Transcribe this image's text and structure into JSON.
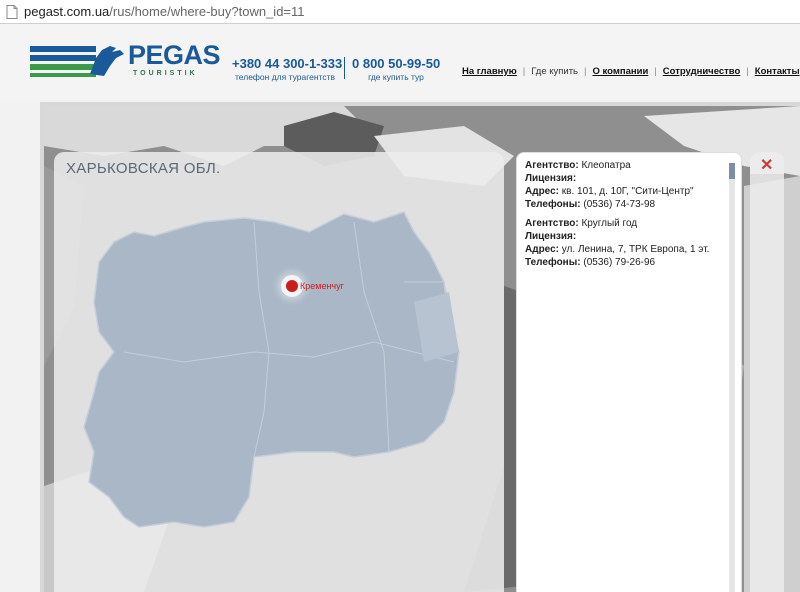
{
  "browser": {
    "url_host": "pegast.com.ua",
    "url_path": "/rus/home/where-buy?town_id=11"
  },
  "header": {
    "logo_word": "PEGAS",
    "logo_sub": "TOURISTIK",
    "phone1": {
      "number": "+380 44 300-1-333",
      "caption": "телефон для турагентств"
    },
    "phone2": {
      "number": "0 800 50-99-50",
      "caption": "где купить тур"
    },
    "nav": [
      {
        "label": "На главную",
        "current": false
      },
      {
        "label": "Где купить",
        "current": true
      },
      {
        "label": "О компании",
        "current": false
      },
      {
        "label": "Сотрудничество",
        "current": false
      },
      {
        "label": "Контакты",
        "current": false
      }
    ]
  },
  "map": {
    "region_title": "ХАРЬКОВСКАЯ ОБЛ.",
    "city": "Кременчуг",
    "region_color": "#a9b7c6"
  },
  "agencies": [
    {
      "agency_label": "Агентство:",
      "agency": "Клеопатра",
      "license_label": "Лицензия:",
      "license": "",
      "address_label": "Адрес:",
      "address": "кв. 101, д. 10Г, \"Сити-Центр\"",
      "phones_label": "Телефоны:",
      "phones": "(0536)  74-73-98"
    },
    {
      "agency_label": "Агентство:",
      "agency": "Круглый год",
      "license_label": "Лицензия:",
      "license": "",
      "address_label": "Адрес:",
      "address": "ул. Ленина, 7, ТРК Европа, 1 эт.",
      "phones_label": "Телефоны:",
      "phones": "(0536) 79-26-96"
    }
  ],
  "close_icon": "close-icon"
}
